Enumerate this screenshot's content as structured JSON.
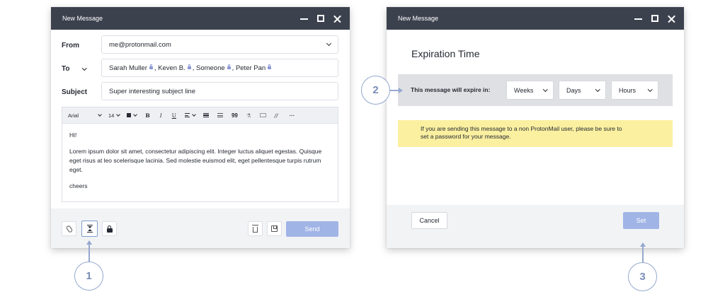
{
  "compose": {
    "window_title": "New Message",
    "from_label": "From",
    "from_value": "me@protonmail.com",
    "to_label": "To",
    "to_recipients": [
      "Sarah Muller",
      "Keven B.",
      "Someone",
      "Peter Pan"
    ],
    "subject_label": "Subject",
    "subject_value": "Super interesting subject line",
    "toolbar": {
      "font": "Arial",
      "size": "14",
      "bold": "B",
      "italic": "I",
      "underline": "U",
      "quote": "99",
      "more": "···",
      "icons": [
        "color-swatch-icon",
        "bold-icon",
        "italic-icon",
        "underline-icon",
        "align-icon",
        "bullet-list-icon",
        "numbered-list-icon",
        "quote-icon",
        "link-icon",
        "image-icon",
        "clear-format-icon",
        "more-icon"
      ]
    },
    "body": {
      "greeting": "Hi!",
      "paragraph": "Lorem ipsum dolor sit amet, consectetur adipiscing elit. Integer luctus aliquet egestas. Quisque eget risus at leo scelerisque lacinia. Sed molestie euismod elit, eget pellentesque turpis rutrum eget.",
      "signoff": "cheers"
    },
    "send_label": "Send",
    "footer_icons": [
      "attachment-icon",
      "hourglass-icon",
      "lock-icon",
      "trash-icon",
      "save-icon"
    ]
  },
  "expiration": {
    "window_title": "New Message",
    "heading": "Expiration Time",
    "expire_label": "This message will expire in:",
    "weeks": "Weeks",
    "days": "Days",
    "hours": "Hours",
    "notice_line1": "If you are sending this message to a non ProtonMail user, please be sure to",
    "notice_line2": "set a password for your message.",
    "cancel_label": "Cancel",
    "set_label": "Set"
  },
  "callouts": {
    "one": "1",
    "two": "2",
    "three": "3"
  },
  "colors": {
    "titlebar": "#3c414e",
    "accent": "#a1b4e6",
    "notice": "#faf0a0",
    "callout": "#94a8cf"
  }
}
